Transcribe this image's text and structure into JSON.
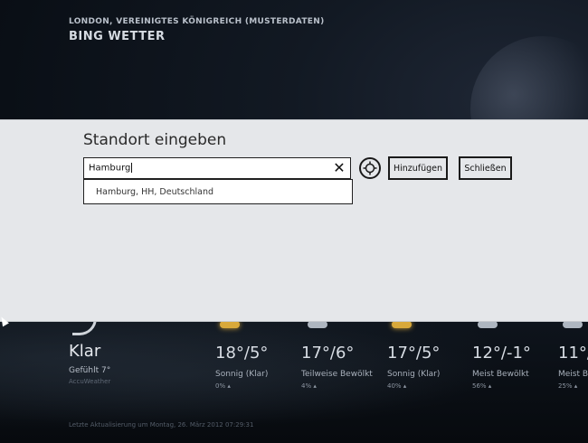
{
  "header": {
    "location": "LONDON, VEREINIGTES KÖNIGREICH (MUSTERDATEN)",
    "app_title": "BING WETTER"
  },
  "current": {
    "condition": "Klar",
    "feels_like": "Gefühlt 7°",
    "source": "AccuWeather"
  },
  "forecast": [
    {
      "temp": "18°/5°",
      "condition": "Sonnig (Klar)",
      "rain": "0% ▴",
      "icon": "sun-icon"
    },
    {
      "temp": "17°/6°",
      "condition": "Teilweise Bewölkt",
      "rain": "4% ▴",
      "icon": "cloud-icon"
    },
    {
      "temp": "17°/5°",
      "condition": "Sonnig (Klar)",
      "rain": "40% ▴",
      "icon": "sun-icon"
    },
    {
      "temp": "12°/-1°",
      "condition": "Meist Bewölkt",
      "rain": "56% ▴",
      "icon": "cloud-icon"
    },
    {
      "temp": "11°/",
      "condition": "Meist B",
      "rain": "25% ▴",
      "icon": "cloud-icon"
    }
  ],
  "last_update": "Letzte Aktualisierung um Montag, 26. März 2012 07:29:31",
  "dialog": {
    "title": "Standort eingeben",
    "search_value": "Hamburg",
    "suggestions": [
      "Hamburg, HH, Deutschland"
    ],
    "add_label": "Hinzufügen",
    "close_label": "Schließen"
  }
}
